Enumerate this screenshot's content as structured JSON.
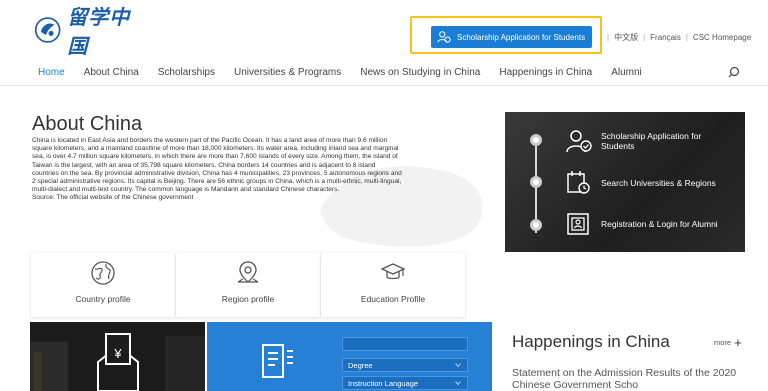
{
  "header": {
    "logo_text": "留学中国",
    "apply_button": "Scholarship Application for Students",
    "lang_links": [
      "中文版",
      "Français",
      "CSC Homepage"
    ]
  },
  "nav": {
    "items": [
      "Home",
      "About China",
      "Scholarships",
      "Universities & Programs",
      "News on Studying in China",
      "Happenings in China",
      "Alumni"
    ],
    "active_index": 0
  },
  "about": {
    "title": "About China",
    "paragraph": "China is located in East Asia and borders the western part of the Pacific Ocean. It has a land area of more than 9.6 million square kilometers, and a mainland coastline of more than 18,000 kilometers. Its water area, including inland sea and marginal sea, is over 4.7 million square kilometers, in which there are more than 7,600 islands of every size. Among them, the island of Taiwan is the largest, with an area of 35,798 square kilometers. China borders 14 countries and is adjacent to 8 island countries on the sea. By provincial administrative division, China has 4 municipalities, 23 provinces, 5 autonomous regions and 2 special administrative regions. Its capital is Beijing. There are 56 ethnic groups in China, which is a multi-ethnic, multi-lingual, multi-dialect and multi-text country. The common language is Mandarin and standard Chinese characters.",
    "source": "Source: The official website of the Chinese government"
  },
  "cards": [
    {
      "label": "Country profile",
      "icon": "globe-icon"
    },
    {
      "label": "Region profile",
      "icon": "map-pin-icon"
    },
    {
      "label": "Education Profile",
      "icon": "graduation-cap-icon"
    }
  ],
  "panel": {
    "items": [
      {
        "label": "Scholarship Application for Students",
        "icon": "student-check-icon"
      },
      {
        "label": "Search Universities & Regions",
        "icon": "calendar-search-icon"
      },
      {
        "label": "Registration & Login for Alumni",
        "icon": "id-card-icon"
      }
    ]
  },
  "search_block": {
    "selects": [
      "Degree",
      "Instruction Language"
    ]
  },
  "happenings": {
    "title": "Happenings in China",
    "more": "more",
    "news": [
      "Statement on the Admission Results of the 2020 Chinese Government Scho"
    ]
  },
  "colors": {
    "accent": "#1a7fd4",
    "highlight": "#f5c21b",
    "blue_block": "#2680d6",
    "panel_dark": "#2a2a2a"
  }
}
